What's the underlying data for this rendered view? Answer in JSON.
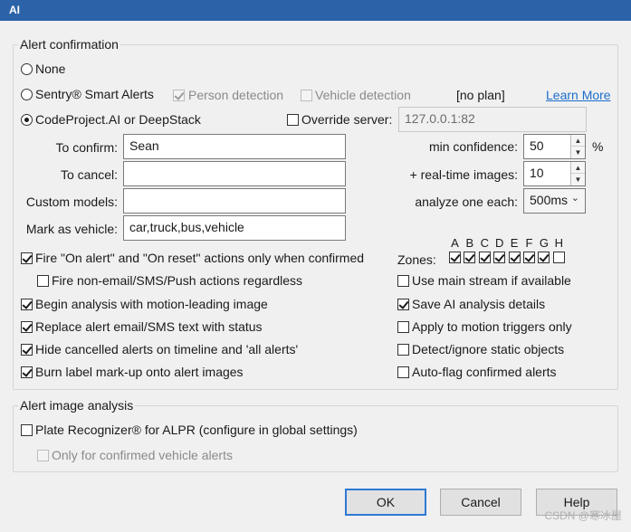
{
  "window": {
    "title": "AI"
  },
  "alert_confirmation": {
    "legend": "Alert confirmation",
    "none_label": "None",
    "sentry_label": "Sentry® Smart Alerts",
    "person_detection_label": "Person detection",
    "vehicle_detection_label": "Vehicle detection",
    "plan_text": "[no plan]",
    "learn_more": "Learn More",
    "codeproject_label": "CodeProject.AI or DeepStack",
    "override_label": "Override server:",
    "override_value": "127.0.0.1:82",
    "to_confirm_label": "To confirm:",
    "to_confirm_value": "Sean",
    "to_cancel_label": "To cancel:",
    "to_cancel_value": "",
    "custom_models_label": "Custom models:",
    "custom_models_value": "",
    "mark_vehicle_label": "Mark as vehicle:",
    "mark_vehicle_value": "car,truck,bus,vehicle",
    "min_confidence_label": "min confidence:",
    "min_confidence_value": "50",
    "percent": "%",
    "realtime_label": "+ real-time images:",
    "realtime_value": "10",
    "analyze_label": "analyze one each:",
    "analyze_value": "500ms",
    "zones_label": "Zones:",
    "zones": [
      "A",
      "B",
      "C",
      "D",
      "E",
      "F",
      "G",
      "H"
    ],
    "zones_checked": [
      true,
      true,
      true,
      true,
      true,
      true,
      true,
      false
    ],
    "options_left": [
      {
        "label": "Fire \"On alert\" and \"On reset\" actions only when confirmed",
        "checked": true
      },
      {
        "label": "Fire non-email/SMS/Push actions regardless",
        "checked": false
      },
      {
        "label": "Begin analysis with motion-leading image",
        "checked": true
      },
      {
        "label": "Replace alert email/SMS text with status",
        "checked": true
      },
      {
        "label": "Hide cancelled alerts on timeline and  'all alerts'",
        "checked": true
      },
      {
        "label": "Burn label mark-up onto alert images",
        "checked": true
      }
    ],
    "options_right": [
      {
        "label": "Use main stream if available",
        "checked": false
      },
      {
        "label": "Save AI analysis details",
        "checked": true
      },
      {
        "label": "Apply to motion triggers only",
        "checked": false
      },
      {
        "label": "Detect/ignore static objects",
        "checked": false
      },
      {
        "label": "Auto-flag confirmed alerts",
        "checked": false
      }
    ]
  },
  "image_analysis": {
    "legend": "Alert image analysis",
    "plate_label": "Plate Recognizer® for ALPR (configure in global settings)",
    "vehicle_only_label": "Only for confirmed vehicle alerts"
  },
  "buttons": {
    "ok": "OK",
    "cancel": "Cancel",
    "help": "Help"
  },
  "watermark": "CSDN @寒冰屋"
}
